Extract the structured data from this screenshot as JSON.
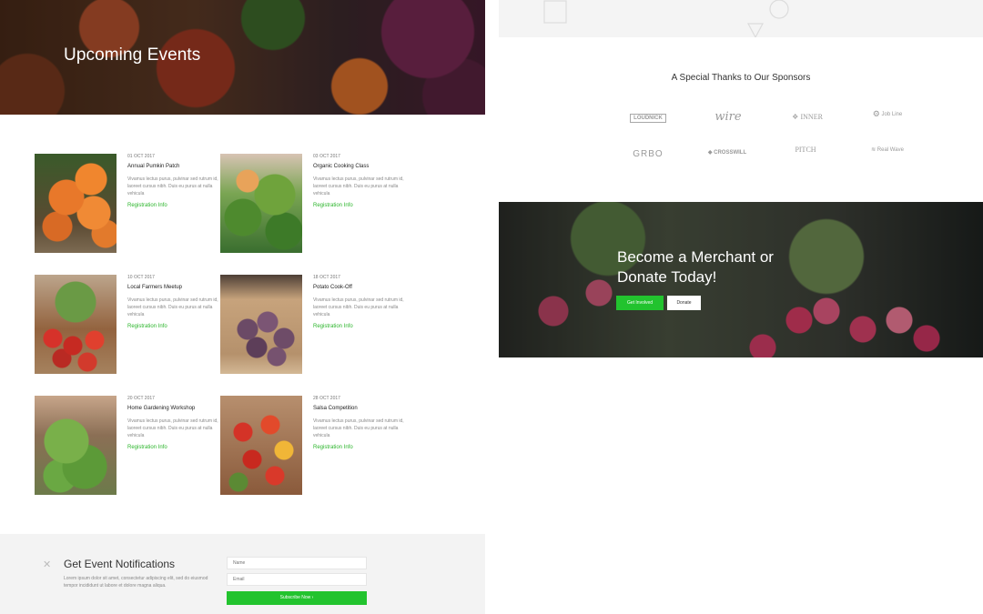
{
  "hero": {
    "title": "Upcoming Events"
  },
  "events": [
    {
      "date": "01 OCT 2017",
      "title": "Annual Pumkin Patch",
      "desc": "Vivamus lectus purus, pulvinar sed rutrum id, laoreet cursus nibh. Duis eu purus at nulla vehicula",
      "link": "Registration Info"
    },
    {
      "date": "03 OCT 2017",
      "title": "Organic Cooking Class",
      "desc": "Vivamus lectus purus, pulvinar sed rutrum id, laoreet cursus nibh. Duis eu purus at nulla vehicula",
      "link": "Registration Info"
    },
    {
      "date": "10 OCT 2017",
      "title": "Local Farmers Meetup",
      "desc": "Vivamus lectus purus, pulvinar sed rutrum id, laoreet cursus nibh. Duis eu purus at nulla vehicula",
      "link": "Registration Info"
    },
    {
      "date": "18 OCT 2017",
      "title": "Potato Cook-Off",
      "desc": "Vivamus lectus purus, pulvinar sed rutrum id, laoreet cursus nibh. Duis eu purus at nulla vehicula",
      "link": "Registration Info"
    },
    {
      "date": "20 OCT 2017",
      "title": "Home Gardening Workshop",
      "desc": "Vivamus lectus purus, pulvinar sed rutrum id, laoreet cursus nibh. Duis eu purus at nulla vehicula",
      "link": "Registration Info"
    },
    {
      "date": "28 OCT 2017",
      "title": "Salsa Competition",
      "desc": "Vivamus lectus purus, pulvinar sed rutrum id, laoreet cursus nibh. Duis eu purus at nulla vehicula",
      "link": "Registration Info"
    }
  ],
  "notifications": {
    "title": "Get Event Notifications",
    "text": "Lorem ipsum dolor sit amet, consectetur adipiscing elit, sed do eiusmod tempor incididunt ut labore et dolore magna aliqua.",
    "name_placeholder": "Name",
    "email_placeholder": "Email",
    "subscribe_label": "Subscribe Now  ›"
  },
  "sponsors": {
    "title": "A Special Thanks to Our Sponsors",
    "logos": [
      "LOUDNICK",
      "wire",
      "INNER",
      "Job Line",
      "GRBO",
      "CROSSWILL",
      "PITCH",
      "Real Wave"
    ]
  },
  "merchant": {
    "title": "Become a Merchant or Donate Today!",
    "involved_label": "Get Involved",
    "donate_label": "Donate"
  },
  "colors": {
    "accent_green": "#22c32e",
    "link_green": "#2bb52b",
    "light_gray": "#f3f3f3"
  }
}
